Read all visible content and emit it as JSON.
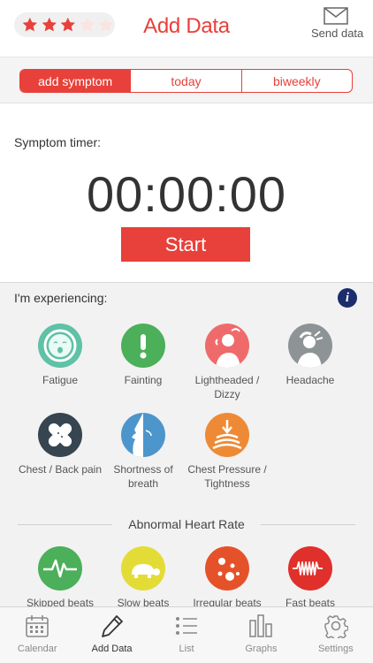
{
  "header": {
    "title": "Add Data",
    "send_label": "Send data",
    "rating": {
      "filled": 3,
      "total": 5
    }
  },
  "tabs": [
    {
      "label": "add symptom",
      "active": true
    },
    {
      "label": "today",
      "active": false
    },
    {
      "label": "biweekly",
      "active": false
    }
  ],
  "timer": {
    "label": "Symptom timer:",
    "value": "00:00:00",
    "start_label": "Start"
  },
  "experiencing": {
    "label": "I'm experiencing:",
    "symptoms": [
      {
        "label": "Fatigue",
        "icon": "fatigue-icon",
        "color": "#5fc1a6"
      },
      {
        "label": "Fainting",
        "icon": "fainting-icon",
        "color": "#4caf5a"
      },
      {
        "label": "Lightheaded / Dizzy",
        "icon": "dizzy-icon",
        "color": "#ef6b6b"
      },
      {
        "label": "Headache",
        "icon": "headache-icon",
        "color": "#8e9496"
      },
      {
        "label": "Chest / Back pain",
        "icon": "bandage-icon",
        "color": "#36454f"
      },
      {
        "label": "Shortness of breath",
        "icon": "breath-icon",
        "color": "#4d96cc"
      },
      {
        "label": "Chest Pressure / Tightness",
        "icon": "chest-pressure-icon",
        "color": "#ee8a35"
      }
    ]
  },
  "abnormal": {
    "label": "Abnormal Heart Rate",
    "items": [
      {
        "label": "Skipped beats",
        "icon": "skipped-beats-icon",
        "color": "#4caf5a"
      },
      {
        "label": "Slow beats",
        "icon": "turtle-icon",
        "color": "#e4dc36"
      },
      {
        "label": "Irregular beats",
        "icon": "irregular-beats-icon",
        "color": "#e5522a"
      },
      {
        "label": "Fast beats",
        "icon": "fast-beats-icon",
        "color": "#e0302c"
      }
    ]
  },
  "nav": [
    {
      "label": "Calendar",
      "icon": "calendar-icon",
      "active": false
    },
    {
      "label": "Add Data",
      "icon": "pencil-icon",
      "active": true
    },
    {
      "label": "List",
      "icon": "list-icon",
      "active": false
    },
    {
      "label": "Graphs",
      "icon": "bar-graph-icon",
      "active": false
    },
    {
      "label": "Settings",
      "icon": "gear-icon",
      "active": false
    }
  ],
  "colors": {
    "accent": "#e8403a",
    "info": "#1b2d6b"
  }
}
